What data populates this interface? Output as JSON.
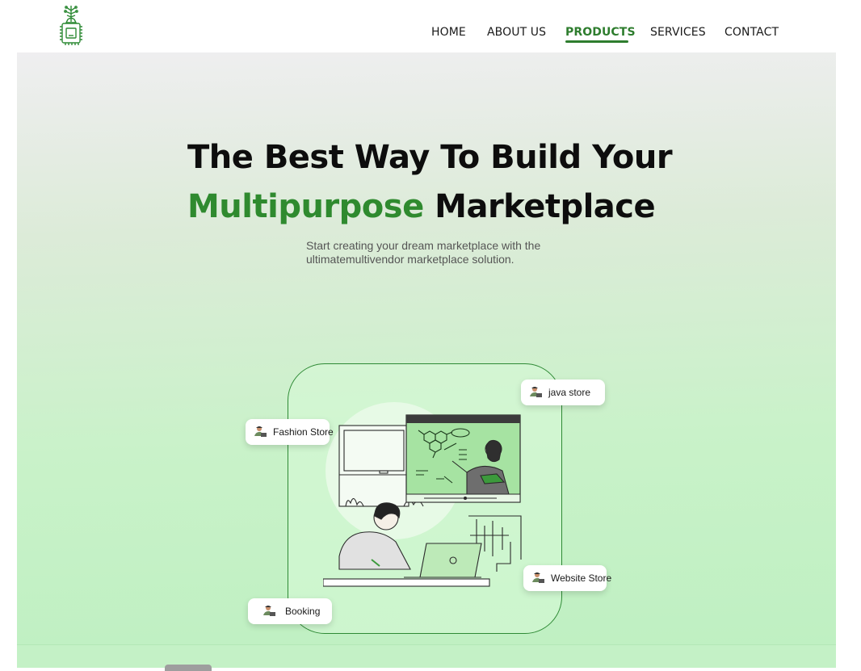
{
  "header": {
    "logo_icon": "chip-tree-logo-icon",
    "nav": [
      {
        "label": "HOME",
        "active": false
      },
      {
        "label": "ABOUT US",
        "active": false
      },
      {
        "label": "PRODUCTS",
        "active": true
      },
      {
        "label": "SERVICES",
        "active": false
      },
      {
        "label": "CONTACT",
        "active": false
      }
    ]
  },
  "hero": {
    "title_line1": "The Best Way To Build Your",
    "title_accent": "Multipurpose",
    "title_line2_rest": " Marketplace",
    "subtitle_line1": "Start creating your dream marketplace with the",
    "subtitle_line2": "ultimatemultivendor marketplace solution.",
    "illustration": "online-learning-illustration",
    "badges": [
      {
        "label": "java store",
        "icon": "person-laptop-icon"
      },
      {
        "label": "Fashion Store",
        "icon": "person-laptop-icon"
      },
      {
        "label": "Website Store",
        "icon": "person-laptop-icon"
      },
      {
        "label": "Booking",
        "icon": "person-laptop-icon"
      }
    ]
  },
  "colors": {
    "accent": "#2f8a2f",
    "nav_active": "#2e7d2e",
    "hero_bg_top": "#efeef0",
    "hero_bg_bottom": "#bff0c2",
    "text": "#0d0d0d"
  }
}
